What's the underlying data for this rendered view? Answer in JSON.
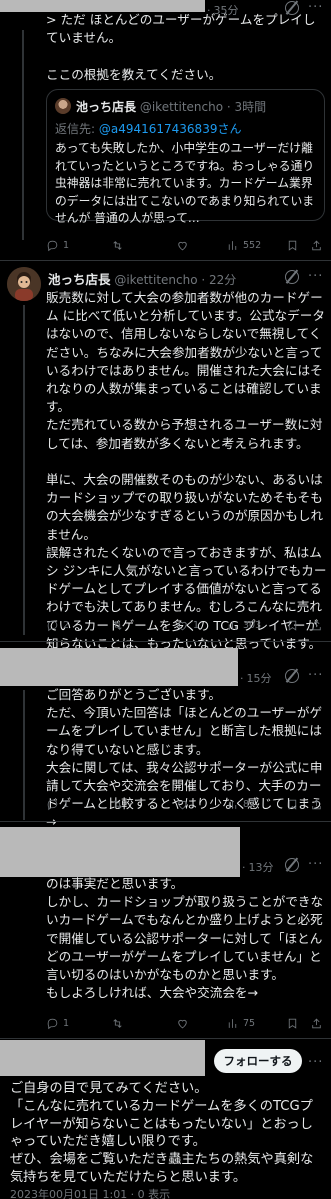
{
  "reply1": {
    "time": "35分",
    "text": "> ただ ほとんどのユーザーがゲームをプレイしていません。\n\nここの根拠を教えてください。",
    "stats": {
      "replies": "1",
      "retweets": "",
      "likes": "",
      "views": "552"
    }
  },
  "quote": {
    "author_name": "池っち店長",
    "author_handle": "@ikettitencho",
    "time": "3時間",
    "reply_prefix": "返信先: ",
    "reply_to": "@a4941617436839さん",
    "text": "あっても失敗したか、小中学生のユーザーだけ離れていったというところですね。おっしゃる通り虫神器は非常に売れています。カードゲーム業界のデータには出てこないのであまり知られていませんが 普通の人が思って…"
  },
  "reply2": {
    "author_name": "池っち店長",
    "author_handle": "@ikettitencho",
    "time": "22分",
    "text": "販売数に対して大会の参加者数が他のカードゲーム に比べて低いと分析しています。公式なデータはないので、信用しないならしないで無視してください。ちなみに大会参加者数が少ないと言っているわけではありません。開催された大会にはそれなりの人数が集まっていることは確認しています。\nただ売れている数から予想されるユーザー数に対しては、参加者数が多くないと考えられます。\n\n単に、大会の開催数そのものが少ない、あるいはカードショップでの取り扱いがないためそもそもの大会機会が少なすぎるというのが原因かもしれません。\n誤解されたくないので言っておきますが、私はムシ ジンキに人気がないと言っているわけでもカードゲームとしてプレイする価値がないと言ってるわけでも決してありません。むしろこんなに売れているカードゲームを多くの TCG プレイヤーが知らないことは、もったいないと思っています。",
    "stats": {
      "replies": "2",
      "retweets": "",
      "likes": "1",
      "views": "303"
    }
  },
  "reply3": {
    "time": "15分",
    "text": "ご回答ありがとうございます。\nただ、今頂いた回答は「ほとんどのユーザーがゲームをプレイしていません」と断言した根拠にはなり得ていないと感じます。\n大会に関しては、我々公認サポーターが公式に申請して大会や交流会を開催しており、大手のカードゲームと比較するとやはり少なく感じてしまう→",
    "stats": {
      "replies": "1",
      "retweets": "",
      "likes": "",
      "views": "87"
    }
  },
  "reply4": {
    "time": "13分",
    "text": "のは事実だと思います。\nしかし、カードショップが取り扱うことができないカードゲームでもなんとか盛り上げようと必死で開催している公認サポーターに対して「ほとんどのユーザーがゲームをプレイしていません」と言い切るのはいかがなものかと思います。\nもしよろしければ、大会や交流会を→",
    "stats": {
      "replies": "1",
      "retweets": "",
      "likes": "",
      "views": "75"
    }
  },
  "follow_button": "フォローする",
  "main_tweet": {
    "text": "ご自身の目で見てみてください。\n「こんなに売れているカードゲームを多くのTCGプレイヤーが知らないことはもったいない」とおっしゃっていただき嬉しい限りです。\nぜひ、会場をご覧いただき蟲主たちの熱気や真剣な気持ちを見ていただけたらと思います。",
    "date": "2023年00月01日 1:01 · 0 表示"
  },
  "colors": {
    "background": "#000000",
    "text": "#e7e9ea",
    "muted": "#71767b",
    "link": "#1d9bf0",
    "divider": "#2f3336",
    "redaction": "#b9b9b9"
  },
  "icons": [
    "reply-icon",
    "retweet-icon",
    "like-icon",
    "views-icon",
    "grok-icon",
    "more-icon",
    "bookmark-icon",
    "share-icon"
  ]
}
